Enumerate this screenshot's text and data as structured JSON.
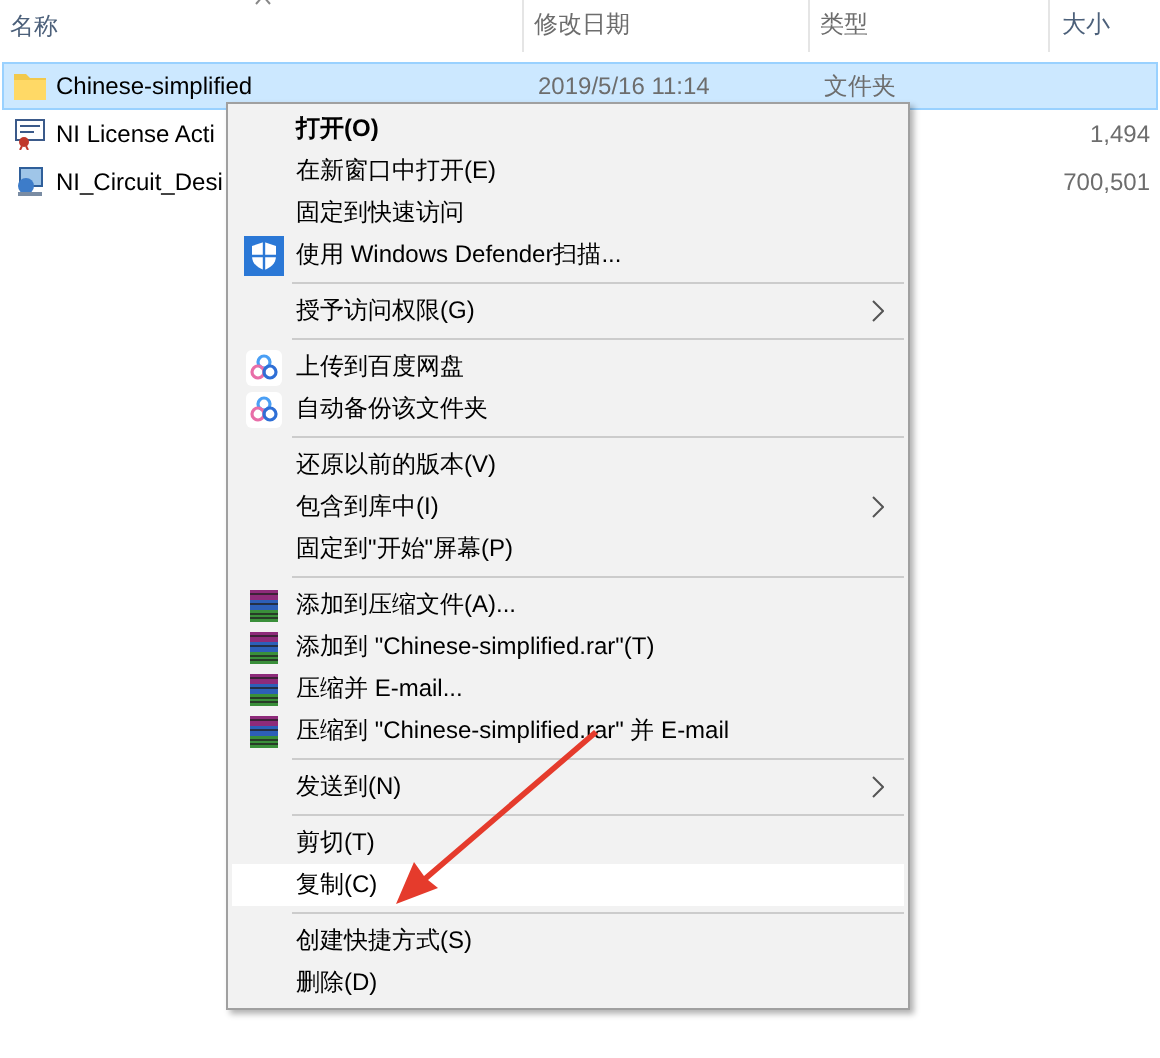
{
  "columns": [
    "名称",
    "修改日期",
    "类型",
    "大小"
  ],
  "files": [
    {
      "kind": "folder",
      "name": "Chinese-simplified",
      "date": "2019/5/16 11:14",
      "type": "文件夹",
      "selected": true
    },
    {
      "kind": "license",
      "name": "NI License Acti",
      "size": "1,494",
      "selected": false
    },
    {
      "kind": "installer",
      "name": "NI_Circuit_Desi",
      "size": "700,501",
      "selected": false
    }
  ],
  "menu": [
    {
      "kind": "default",
      "label": "打开(O)",
      "submenu": false,
      "selected": false
    },
    {
      "kind": "item",
      "label": "在新窗口中打开(E)",
      "submenu": false,
      "selected": false
    },
    {
      "kind": "item",
      "label": "固定到快速访问",
      "submenu": false,
      "selected": false
    },
    {
      "kind": "shield",
      "label": "使用 Windows Defender扫描...",
      "submenu": false,
      "selected": false
    },
    {
      "kind": "separator"
    },
    {
      "kind": "item",
      "label": "授予访问权限(G)",
      "submenu": true,
      "selected": false
    },
    {
      "kind": "separator"
    },
    {
      "kind": "cloud",
      "label": "上传到百度网盘",
      "submenu": false,
      "selected": false
    },
    {
      "kind": "cloud",
      "label": "自动备份该文件夹",
      "submenu": false,
      "selected": false
    },
    {
      "kind": "separator"
    },
    {
      "kind": "item",
      "label": "还原以前的版本(V)",
      "submenu": false,
      "selected": false
    },
    {
      "kind": "item",
      "label": "包含到库中(I)",
      "submenu": true,
      "selected": false
    },
    {
      "kind": "item",
      "label": "固定到\"开始\"屏幕(P)",
      "submenu": false,
      "selected": false
    },
    {
      "kind": "separator"
    },
    {
      "kind": "archive",
      "label": "添加到压缩文件(A)...",
      "submenu": false,
      "selected": false
    },
    {
      "kind": "archive",
      "label": "添加到 \"Chinese-simplified.rar\"(T)",
      "submenu": false,
      "selected": false
    },
    {
      "kind": "archive",
      "label": "压缩并 E-mail...",
      "submenu": false,
      "selected": false
    },
    {
      "kind": "archive",
      "label": "压缩到 \"Chinese-simplified.rar\" 并 E-mail",
      "submenu": false,
      "selected": false
    },
    {
      "kind": "separator"
    },
    {
      "kind": "item",
      "label": "发送到(N)",
      "submenu": true,
      "selected": false
    },
    {
      "kind": "separator"
    },
    {
      "kind": "item",
      "label": "剪切(T)",
      "submenu": false,
      "selected": false
    },
    {
      "kind": "item",
      "label": "复制(C)",
      "submenu": false,
      "selected": true
    },
    {
      "kind": "separator"
    },
    {
      "kind": "item",
      "label": "创建快捷方式(S)",
      "submenu": false,
      "selected": false
    },
    {
      "kind": "item",
      "label": "删除(D)",
      "submenu": false,
      "selected": false
    }
  ]
}
